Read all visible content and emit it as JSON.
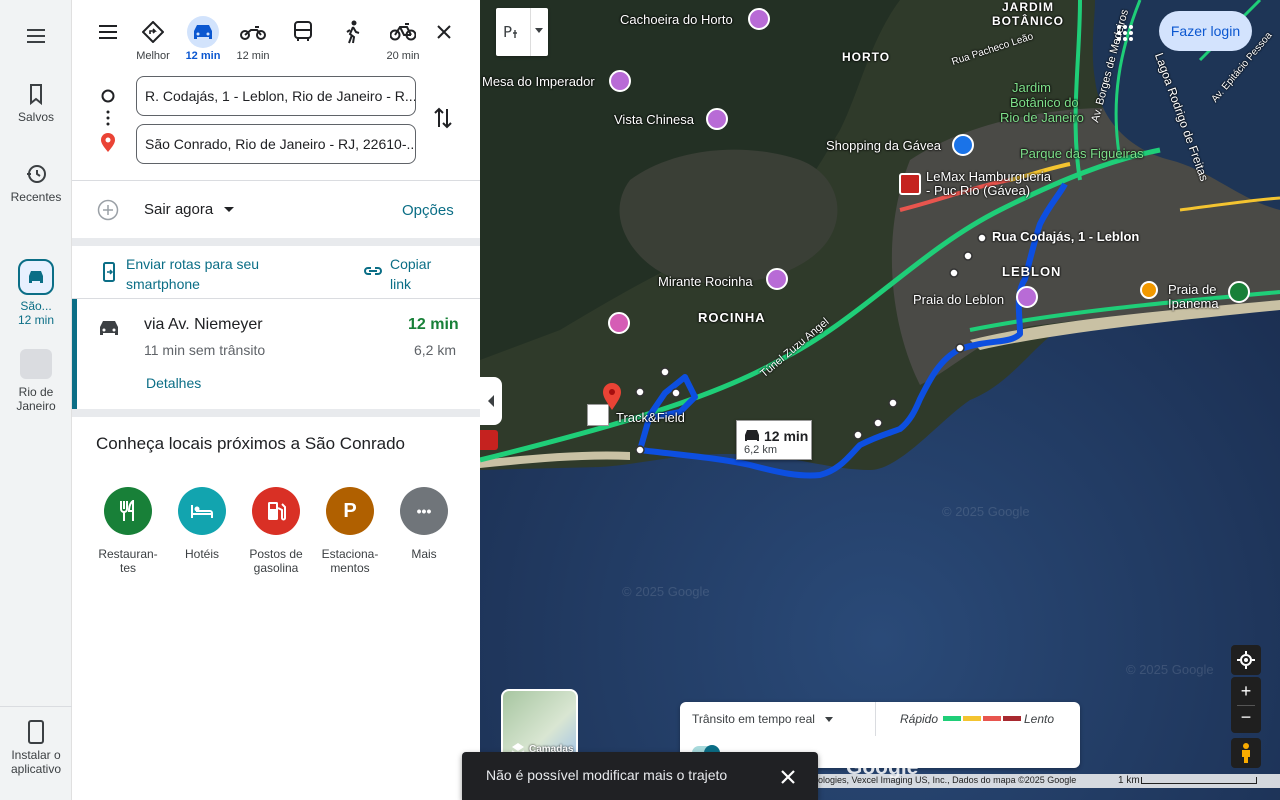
{
  "rail": {
    "saved": "Salvos",
    "recent": "Recentes",
    "trip_label_1": "São...",
    "trip_label_2": "12 min",
    "place_label_1": "Rio de",
    "place_label_2": "Janeiro",
    "install_1": "Instalar o",
    "install_2": "aplicativo"
  },
  "modes": [
    {
      "name": "Melhor",
      "time": "Melhor"
    },
    {
      "name": "Carro",
      "time": "12 min"
    },
    {
      "name": "Moto",
      "time": "12 min"
    },
    {
      "name": "Transporte público",
      "time": ""
    },
    {
      "name": "A pé",
      "time": ""
    },
    {
      "name": "Bicicleta",
      "time": "20 min"
    }
  ],
  "origin": "R. Codajás, 1 - Leblon, Rio de Janeiro - R...",
  "destination": "São Conrado, Rio de Janeiro - RJ, 22610-...",
  "depart": "Sair agora",
  "options": "Opções",
  "send": {
    "line1": "Enviar rotas para seu",
    "line2": "smartphone"
  },
  "copy": {
    "line1": "Copiar",
    "line2": "link"
  },
  "route": {
    "via": "via Av. Niemeyer",
    "time": "12 min",
    "traffic": "11 min sem trânsito",
    "dist": "6,2 km",
    "details": "Detalhes"
  },
  "nearby": {
    "title": "Conheça locais próximos a São Conrado",
    "cats": [
      {
        "l1": "Restauran-",
        "l2": "tes",
        "color": "#188038"
      },
      {
        "l1": "Hotéis",
        "l2": "",
        "color": "#12a4af"
      },
      {
        "l1": "Postos de",
        "l2": "gasolina",
        "color": "#d93025"
      },
      {
        "l1": "Estaciona-",
        "l2": "mentos",
        "color": "#b06000"
      },
      {
        "l1": "Mais",
        "l2": "",
        "color": "#70757a"
      }
    ]
  },
  "map": {
    "login": "Fazer login",
    "labels": {
      "cachoeira": "Cachoeira do Horto",
      "mesa": "Mesa do Imperador",
      "vista": "Vista Chinesa",
      "horto": "HORTO",
      "jardim": "JARDIM",
      "botanico": "BOTÂNICO",
      "jb1": "Jardim",
      "jb2": "Botânico do",
      "jb3": "Rio de Janeiro",
      "shopping": "Shopping da Gávea",
      "parque": "Parque das Figueiras",
      "lemax1": "LeMax Hamburgueria",
      "lemax2": "- Puc Rio (Gávea)",
      "codajas": "Rua Codajás, 1 - Leblon",
      "leblon": "LEBLON",
      "praia_leblon": "Praia do Leblon",
      "praia_ipanema1": "Praia de",
      "praia_ipanema2": "Ipanema",
      "mirante": "Mirante Rocinha",
      "rocinha": "ROCINHA",
      "track": "Track&Field",
      "tunel": "Túnel Zuzu Angel",
      "pacheco": "Rua Pacheco Leão",
      "borges": "Av. Borges de Medeiros",
      "lagoa": "Lagoa Rodrigo de Freitas",
      "epitacio": "Av. Epitácio Pessoa"
    },
    "callout_time": "12 min",
    "callout_dist": "6,2 km",
    "traffic_label": "Trânsito em tempo real",
    "fast": "Rápido",
    "slow": "Lento",
    "layers": "Camadas",
    "attribution": "ologies, Vexcel Imaging US, Inc., Dados do mapa ©2025 Google",
    "scale": "1 km",
    "google": "Google",
    "watermark": "© 2025 Google",
    "traffic_colors": [
      "#1fce78",
      "#f4c430",
      "#e8554e",
      "#a8292f"
    ]
  },
  "toast": "Não é possível modificar mais o trajeto"
}
